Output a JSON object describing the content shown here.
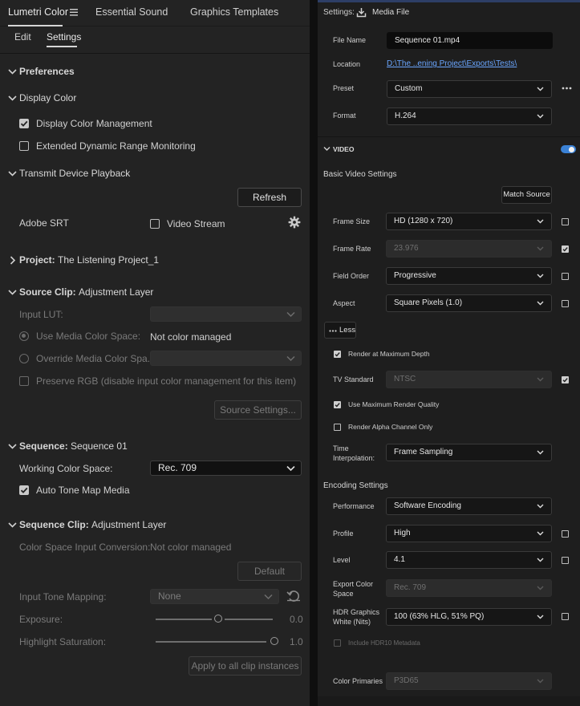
{
  "left": {
    "tabs": [
      "Lumetri Color",
      "Essential Sound",
      "Graphics Templates"
    ],
    "subtabs": [
      "Edit",
      "Settings"
    ],
    "preferences": "Preferences",
    "display_color": {
      "header": "Display Color",
      "display_color_management": "Display Color Management",
      "extended_range": "Extended Dynamic Range Monitoring"
    },
    "transmit": {
      "header": "Transmit Device Playback",
      "refresh": "Refresh",
      "adobe_srt": "Adobe SRT",
      "video_stream": "Video Stream"
    },
    "project": {
      "prefix": "Project:",
      "name": "The Listening Project_1"
    },
    "source_clip": {
      "prefix": "Source Clip:",
      "name": "Adjustment Layer",
      "input_lut": "Input LUT:",
      "use_media_cs": "Use Media Color Space:",
      "not_managed": "Not color managed",
      "override_cs": "Override Media Color Spa...",
      "preserve_rgb": "Preserve RGB (disable input color management for this item)",
      "source_settings": "Source Settings..."
    },
    "sequence": {
      "prefix": "Sequence:",
      "name": "Sequence 01",
      "working_cs": "Working Color Space:",
      "working_cs_value": "Rec. 709",
      "auto_tone": "Auto Tone Map Media"
    },
    "sequence_clip": {
      "prefix": "Sequence Clip:",
      "name": "Adjustment Layer",
      "cs_input_conv": "Color Space Input Conversion:",
      "not_managed": "Not color managed",
      "default": "Default",
      "input_tone": "Input Tone Mapping:",
      "input_tone_value": "None",
      "exposure": "Exposure:",
      "exposure_value": "0.0",
      "exposure_level": 0.5,
      "highlight_sat": "Highlight Saturation:",
      "highlight_sat_value": "1.0",
      "highlight_level": 1.0,
      "apply_all": "Apply to all clip instances"
    }
  },
  "right": {
    "settings_label": "Settings:",
    "media_file": "Media File",
    "file_name_label": "File Name",
    "file_name_value": "Sequence 01.mp4",
    "location_label": "Location",
    "location_value": "D:\\The ..ening Project\\Exports\\Tests\\",
    "preset_label": "Preset",
    "preset_value": "Custom",
    "format_label": "Format",
    "format_value": "H.264",
    "video_header": "VIDEO",
    "basic_video": "Basic Video Settings",
    "match_source": "Match Source",
    "frame_size_label": "Frame Size",
    "frame_size_value": "HD (1280 x 720)",
    "frame_rate_label": "Frame Rate",
    "frame_rate_value": "23.976",
    "field_order_label": "Field Order",
    "field_order_value": "Progressive",
    "aspect_label": "Aspect",
    "aspect_value": "Square Pixels (1.0)",
    "less": "Less",
    "render_max_depth": "Render at Maximum Depth",
    "tv_standard_label": "TV Standard",
    "tv_standard_value": "NTSC",
    "max_render_quality": "Use Maximum Render Quality",
    "render_alpha": "Render Alpha Channel Only",
    "time_interp_label_1": "Time",
    "time_interp_label_2": "Interpolation:",
    "time_interp_value": "Frame Sampling",
    "encoding_settings": "Encoding Settings",
    "performance_label": "Performance",
    "performance_value": "Software Encoding",
    "profile_label": "Profile",
    "profile_value": "High",
    "level_label": "Level",
    "level_value": "4.1",
    "export_cs_label_1": "Export Color",
    "export_cs_label_2": "Space",
    "export_cs_value": "Rec. 709",
    "hdr_white_label_1": "HDR Graphics",
    "hdr_white_label_2": "White (Nits)",
    "hdr_white_value": "100 (63% HLG, 51% PQ)",
    "include_hdr10": "Include HDR10 Metadata",
    "color_primaries_label": "Color Primaries",
    "color_primaries_value": "P3D65"
  },
  "colors": {
    "toggle_accent": "#3b82d6",
    "link": "#6aa6ff"
  }
}
